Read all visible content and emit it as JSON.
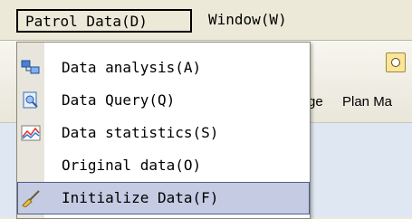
{
  "menubar": {
    "patrol_data": "Patrol Data(D)",
    "window": "Window(W)"
  },
  "toolbar": {
    "labels": [
      "ge",
      "Plan Ma"
    ]
  },
  "dropdown": {
    "items": [
      {
        "label": "Data analysis(A)",
        "icon": "data-analysis-icon"
      },
      {
        "label": "Data Query(Q)",
        "icon": "data-query-icon"
      },
      {
        "label": "Data statistics(S)",
        "icon": "data-statistics-icon"
      },
      {
        "label": "Original data(O)",
        "icon": ""
      },
      {
        "label": "Initialize Data(F)",
        "icon": "broom-icon",
        "selected": true
      }
    ]
  },
  "colors": {
    "menu_bg": "#ece9d8",
    "selected_bg": "#c4cbe3"
  }
}
